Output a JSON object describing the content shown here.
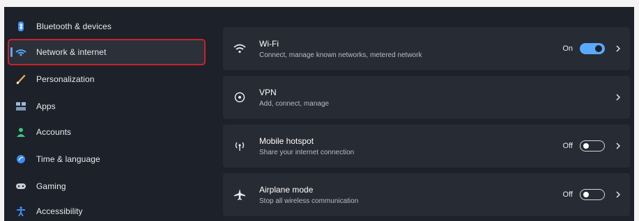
{
  "sidebar": {
    "items": [
      {
        "label": "Bluetooth & devices",
        "icon": "bluetooth-icon"
      },
      {
        "label": "Network & internet",
        "icon": "network-icon",
        "active": true
      },
      {
        "label": "Personalization",
        "icon": "brush-icon"
      },
      {
        "label": "Apps",
        "icon": "apps-icon"
      },
      {
        "label": "Accounts",
        "icon": "account-icon"
      },
      {
        "label": "Time & language",
        "icon": "globe-clock-icon"
      },
      {
        "label": "Gaming",
        "icon": "controller-icon"
      },
      {
        "label": "Accessibility",
        "icon": "accessibility-icon"
      }
    ]
  },
  "main": {
    "cards": [
      {
        "title": "Wi-Fi",
        "subtitle": "Connect, manage known networks, metered network",
        "state": "On",
        "toggle": true,
        "icon": "wifi-icon"
      },
      {
        "title": "VPN",
        "subtitle": "Add, connect, manage",
        "icon": "vpn-shield-icon"
      },
      {
        "title": "Mobile hotspot",
        "subtitle": "Share your internet connection",
        "state": "Off",
        "toggle": false,
        "icon": "hotspot-icon"
      },
      {
        "title": "Airplane mode",
        "subtitle": "Stop all wireless communication",
        "state": "Off",
        "toggle": false,
        "icon": "airplane-icon"
      }
    ]
  },
  "colors": {
    "accent": "#5aa9ff",
    "background": "#1d2129",
    "card": "#272b33",
    "highlight_outline": "#c8232b"
  }
}
